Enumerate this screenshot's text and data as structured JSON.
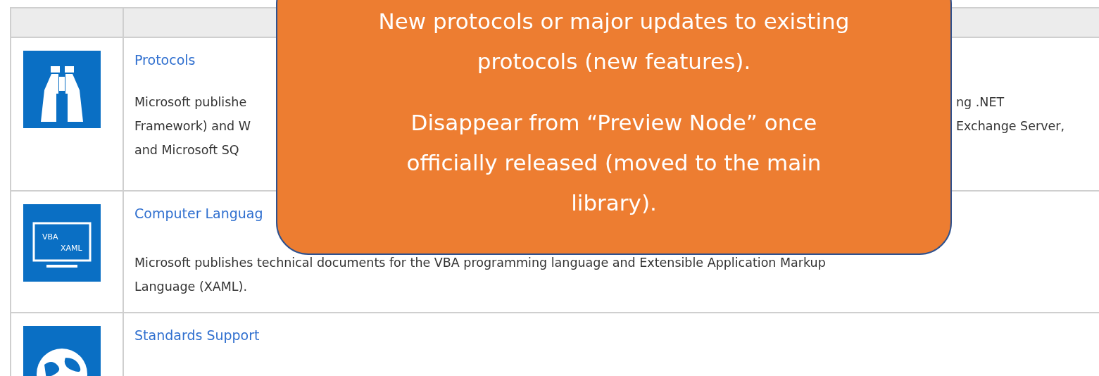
{
  "table": {
    "rows": [
      {
        "kind": "binoculars",
        "title": "Protocols",
        "description_lines": [
          {
            "left": "Microsoft publishe",
            "right": "ng .NET"
          },
          {
            "left": "Framework) and W",
            "right": "Exchange Server,"
          },
          {
            "left": "and Microsoft SQ"
          }
        ]
      },
      {
        "kind": "monitor",
        "icon_labels": [
          "VBA",
          "XAML"
        ],
        "title": "Computer Languag",
        "description_lines": [
          {
            "left": "Microsoft publishes technical documents for the VBA programming language and Extensible Application Markup"
          },
          {
            "left": "Language (XAML)."
          }
        ]
      },
      {
        "kind": "globe",
        "title": "Standards Support",
        "description_lines": []
      }
    ]
  },
  "callout": {
    "paragraphs": [
      [
        "New protocols or major updates to existing",
        "protocols (new features)."
      ],
      [
        "Disappear from “Preview Node” once",
        "officially released (moved to the main",
        "library)."
      ]
    ]
  }
}
